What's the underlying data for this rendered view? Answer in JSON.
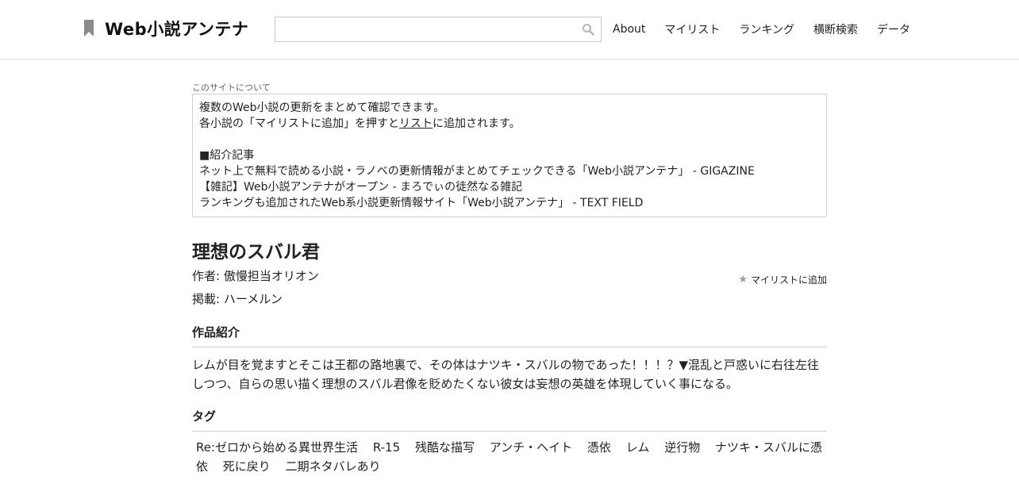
{
  "header": {
    "logo_text": "Web小説アンテナ",
    "search": {
      "value": "",
      "placeholder": ""
    },
    "nav": [
      "About",
      "マイリスト",
      "ランキング",
      "横断検索",
      "データ"
    ]
  },
  "about": {
    "caption": "このサイトについて",
    "line1": "複数のWeb小説の更新をまとめて確認できます。",
    "line2_pre": "各小説の「マイリストに追加」を押すと",
    "line2_link": "リスト",
    "line2_post": "に追加されます。",
    "articles_heading": "■紹介記事",
    "articles": [
      "ネット上で無料で読める小説・ラノベの更新情報がまとめてチェックできる「Web小説アンテナ」 - GIGAZINE",
      "【雑記】Web小説アンテナがオープン - まろでぃの徒然なる雑記",
      "ランキングも追加されたWeb系小説更新情報サイト「Web小説アンテナ」 - TEXT FIELD"
    ]
  },
  "novel": {
    "title": "理想のスバル君",
    "mylist_add": "マイリストに追加",
    "author": "作者: 傲慢担当オリオン",
    "site": "掲載: ハーメルン",
    "intro_heading": "作品紹介",
    "intro": "レムが目を覚ますとそこは王都の路地裏で、その体はナツキ・スバルの物であった！！！？▼混乱と戸惑いに右往左往しつつ、自らの思い描く理想のスバル君像を貶めたくない彼女は妄想の英雄を体現していく事になる。",
    "tags_heading": "タグ",
    "tags": [
      "Re:ゼロから始める異世界生活",
      "R-15",
      "残酷な描写",
      "アンチ・ヘイト",
      "憑依",
      "レム",
      "逆行物",
      "ナツキ・スバルに憑依",
      "死に戻り",
      "二期ネタバレあり"
    ]
  }
}
